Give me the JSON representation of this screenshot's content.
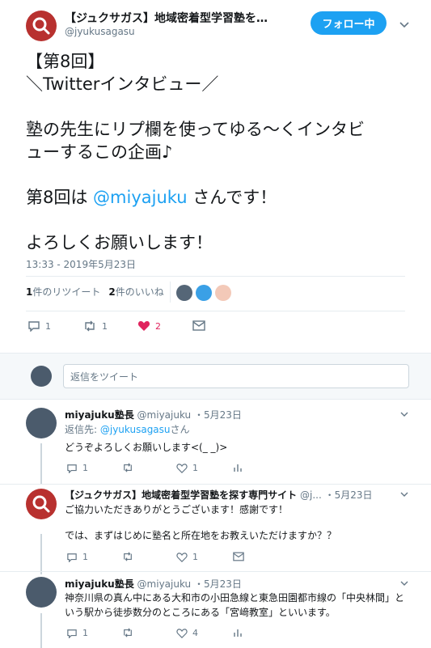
{
  "main": {
    "display_name": "【ジュクサガス】地域密着型学習塾を探す専門サイト",
    "handle": "@jyukusagasu",
    "follow_label": "フォロー中",
    "text_line1": "【第8回】",
    "text_line2": "＼Twitterインタビュー／",
    "text_line3": "塾の先生にリプ欄を使ってゆる〜くインタビ",
    "text_line4": "ューするこの企画♪",
    "text_prefix5": "第8回は ",
    "text_mention5": "@miyajuku",
    "text_suffix5": " さんです！",
    "text_line6": "よろしくお願いします！",
    "timestamp": "13:33 - 2019年5月23日",
    "retweets_count": "1",
    "retweets_label": "件のリツイート",
    "likes_count": "2",
    "likes_label": "件のいいね",
    "reply_count": "1",
    "retweet_count": "1",
    "like_count": "2",
    "colors": {
      "accent": "#1da1f2",
      "brand": "#b8312f",
      "like": "#e0245e"
    }
  },
  "reply_box": {
    "placeholder": "返信をツイート"
  },
  "replies": [
    {
      "name": "miyajuku塾長",
      "handle": "@miyajuku",
      "date": "・5月23日",
      "reply_to_label": "返信先: ",
      "reply_to_handle": "@jyukusagasu",
      "reply_to_suffix": "さん",
      "text": "どうぞよろしくお願いします<(_ _)>",
      "reply_count": "1",
      "like_count": "1"
    },
    {
      "name": "【ジュクサガス】地域密着型学習塾を探す専門サイト",
      "handle": "@j...",
      "date": "・5月23日",
      "text1": "ご協力いただきありがとうございます！感謝です！",
      "text2": "では、まずはじめに塾名と所在地をお教えいただけますか？？",
      "reply_count": "1",
      "like_count": "1"
    },
    {
      "name": "miyajuku塾長",
      "handle": "@miyajuku",
      "date": "・5月23日",
      "text": "神奈川県の真ん中にある大和市の小田急線と東急田園都市線の「中央林間」という駅から徒歩数分のところにある「宮﨑教室」といいます。",
      "reply_count": "1",
      "like_count": "4"
    }
  ]
}
